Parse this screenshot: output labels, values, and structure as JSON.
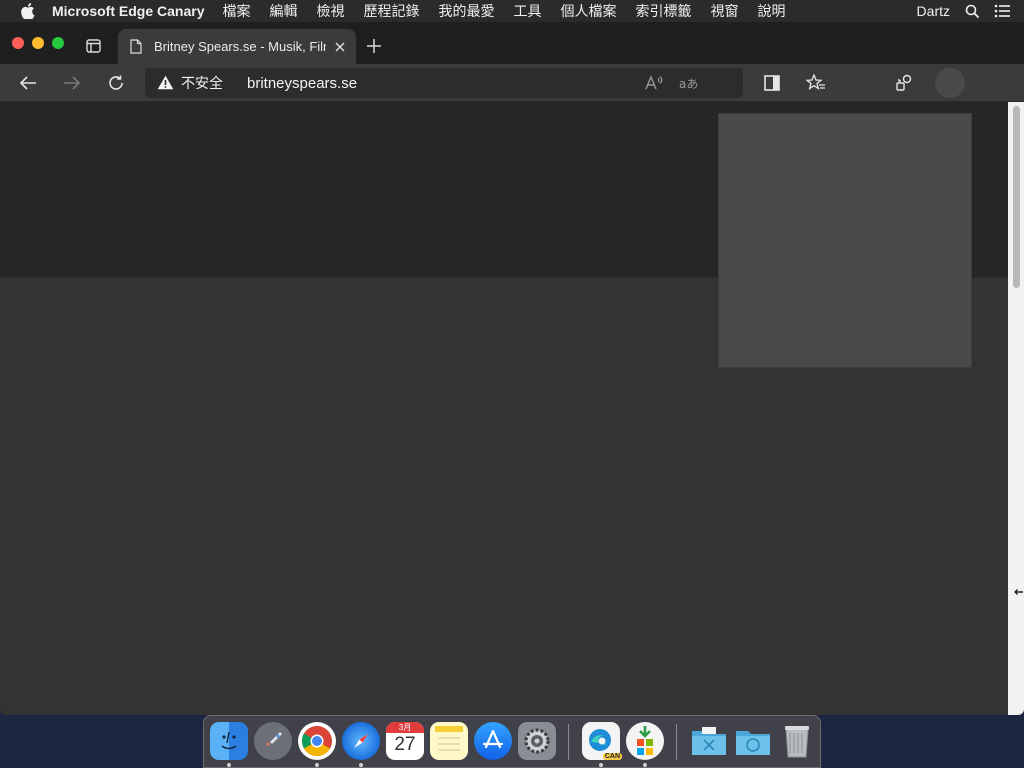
{
  "menubar": {
    "app_name": "Microsoft Edge Canary",
    "items": [
      "檔案",
      "編輯",
      "檢視",
      "歷程記錄",
      "我的最愛",
      "工具",
      "個人檔案",
      "索引標籤",
      "視窗",
      "說明"
    ],
    "user": "Dartz"
  },
  "browser": {
    "tab_title": "Britney Spears.se - Musik, Film",
    "security_label": "不安全",
    "url": "britneyspears.se"
  },
  "dock": {
    "calendar_day": "27",
    "calendar_month": "3月",
    "edge_badge": "CAN"
  }
}
